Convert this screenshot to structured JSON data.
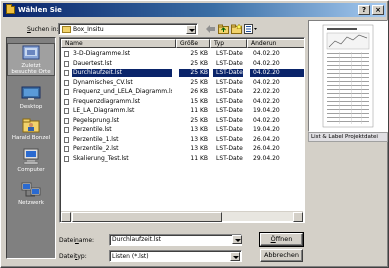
{
  "window": {
    "title": "Wählen Sie",
    "help_btn": "?",
    "close_btn": "×"
  },
  "lookin": {
    "label_prefix": "S",
    "label_rest": "uchen in:",
    "value": "Box_Insitu"
  },
  "places": [
    {
      "label": "Zuletzt besuchte Orte",
      "icon": "recent-places-icon"
    },
    {
      "label": "Desktop",
      "icon": "desktop-icon"
    },
    {
      "label": "Harald Bonzel",
      "icon": "user-folder-icon"
    },
    {
      "label": "Computer",
      "icon": "computer-icon"
    },
    {
      "label": "Netzwerk",
      "icon": "network-icon"
    }
  ],
  "columns": {
    "name": "Name",
    "size": "Größe",
    "type": "Typ",
    "date": "Änderun"
  },
  "files": [
    {
      "name": "3-D-Diagramme.lst",
      "size": "25 KB",
      "type": "LST-Datei",
      "date": "04.02.20"
    },
    {
      "name": "Dauertest.lst",
      "size": "25 KB",
      "type": "LST-Datei",
      "date": "04.02.20"
    },
    {
      "name": "Durchlaufzeit.lst",
      "size": "25 KB",
      "type": "LST-Datei",
      "date": "04.02.20"
    },
    {
      "name": "Dynamisches_CV.lst",
      "size": "25 KB",
      "type": "LST-Datei",
      "date": "04.02.20"
    },
    {
      "name": "Frequenz_und_LELA_Diagramm.lst",
      "size": "26 KB",
      "type": "LST-Datei",
      "date": "22.02.20"
    },
    {
      "name": "Frequenzdiagramm.lst",
      "size": "15 KB",
      "type": "LST-Datei",
      "date": "04.02.20"
    },
    {
      "name": "LE_LA_Diagramm.lst",
      "size": "11 KB",
      "type": "LST-Datei",
      "date": "19.04.20"
    },
    {
      "name": "Pegelsprung.lst",
      "size": "25 KB",
      "type": "LST-Datei",
      "date": "04.02.20"
    },
    {
      "name": "Perzentile.lst",
      "size": "13 KB",
      "type": "LST-Datei",
      "date": "19.04.20"
    },
    {
      "name": "Perzentile_1.lst",
      "size": "13 KB",
      "type": "LST-Datei",
      "date": "26.04.20"
    },
    {
      "name": "Perzentile_2.lst",
      "size": "13 KB",
      "type": "LST-Datei",
      "date": "26.04.20"
    },
    {
      "name": "Skalierung_Test.lst",
      "size": "11 KB",
      "type": "LST-Datei",
      "date": "29.04.20"
    }
  ],
  "selected_index": 2,
  "preview": {
    "caption": "List & Label Projektdatei"
  },
  "filename": {
    "label_prefix": "Datei",
    "label_underlined": "n",
    "label_rest": "ame:",
    "value": "Durchlaufzeit.lst"
  },
  "filetype": {
    "label_prefix": "Datei",
    "label_underlined": "t",
    "label_rest": "yp:",
    "value": "Listen (*.lst)"
  },
  "buttons": {
    "open_prefix": "Ö",
    "open_rest": "ffnen",
    "cancel": "Abbrechen"
  }
}
